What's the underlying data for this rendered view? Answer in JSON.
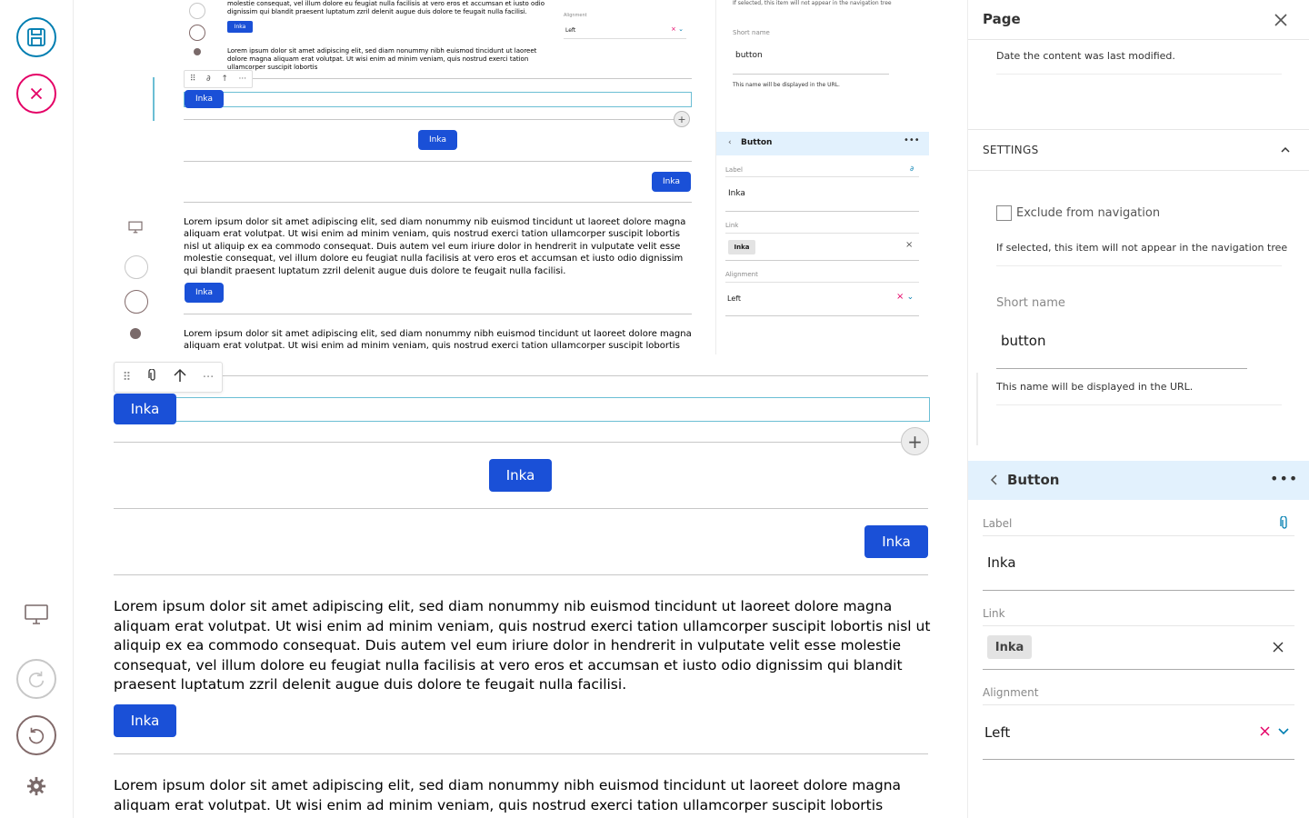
{
  "toolbar": {
    "save": "save-icon",
    "cancel": "cancel-icon",
    "display": "display-icon",
    "redo": "redo-icon",
    "undo": "undo-icon",
    "settings": "gear-icon"
  },
  "editor": {
    "button_label": "Inka",
    "paragraph_long": "Lorem ipsum dolor sit amet adipiscing elit, sed diam nonummy nib euismod tincidunt ut laoreet dolore magna aliquam erat volutpat. Ut wisi enim ad minim veniam, quis nostrud exerci tation ullamcorper suscipit lobortis nisl ut aliquip ex ea commodo consequat. Duis autem vel eum iriure dolor in hendrerit in vulputate velit esse molestie consequat, vel illum dolore eu feugiat nulla facilisis at vero eros et accumsan et iusto odio dignissim qui blandit praesent luptatum zzril delenit augue duis dolore te feugait nulla facilisi.",
    "paragraph_short": "Lorem ipsum dolor sit amet adipiscing elit, sed diam nonummy nibh euismod tincidunt ut laoreet dolore magna aliquam erat volutpat. Ut wisi enim ad minim veniam, quis nostrud exerci tation ullamcorper suscipit lobortis",
    "nested_top_text": "molestie consequat, vel illum dolore eu feugiat nulla facilisis at vero eros et accumsan et iusto odio dignissim qui blandit praesent luptatum zzril delenit augue duis dolore te feugait nulla facilisi.",
    "nested_short_para": "Lorem ipsum dolor sit amet adipiscing elit, sed diam nonummy nibh euismod tincidunt ut laoreet dolore magna aliquam erat volutpat. Ut wisi enim ad minim veniam, quis nostrud exerci tation ullamcorper suscipit lobortis",
    "nested_alignment_label": "Alignment",
    "nested_left": "Left",
    "nested_tree_text": "If selected, this item will not appear in the navigation tree",
    "nested_short_name_label": "Short name",
    "nested_short_name_value": "button",
    "nested_short_name_help": "This name will be displayed in the URL.",
    "nested_button_title": "Button",
    "nested_label_label": "Label",
    "nested_label_value": "Inka",
    "nested_link_label": "Link",
    "nested_link_value": "Inka",
    "nested_align_label": "Alignment",
    "nested_align_value": "Left"
  },
  "sidebar": {
    "title": "Page",
    "modified_help": "Date the content was last modified.",
    "settings_title": "SETTINGS",
    "exclude_label": "Exclude from navigation",
    "exclude_help": "If selected, this item will not appear in the navigation tree",
    "short_name_label": "Short name",
    "short_name_value": "button",
    "short_name_help": "This name will be displayed in the URL.",
    "block_title": "Button",
    "label_label": "Label",
    "label_value": "Inka",
    "link_label": "Link",
    "link_value": "Inka",
    "alignment_label": "Alignment",
    "alignment_value": "Left"
  },
  "colors": {
    "accent_blue": "#1a50d7",
    "save_blue": "#007eb1",
    "cancel_pink": "#e40166",
    "block_header_bg": "#e2f1fd",
    "selection_bar": "#6bbed4"
  }
}
